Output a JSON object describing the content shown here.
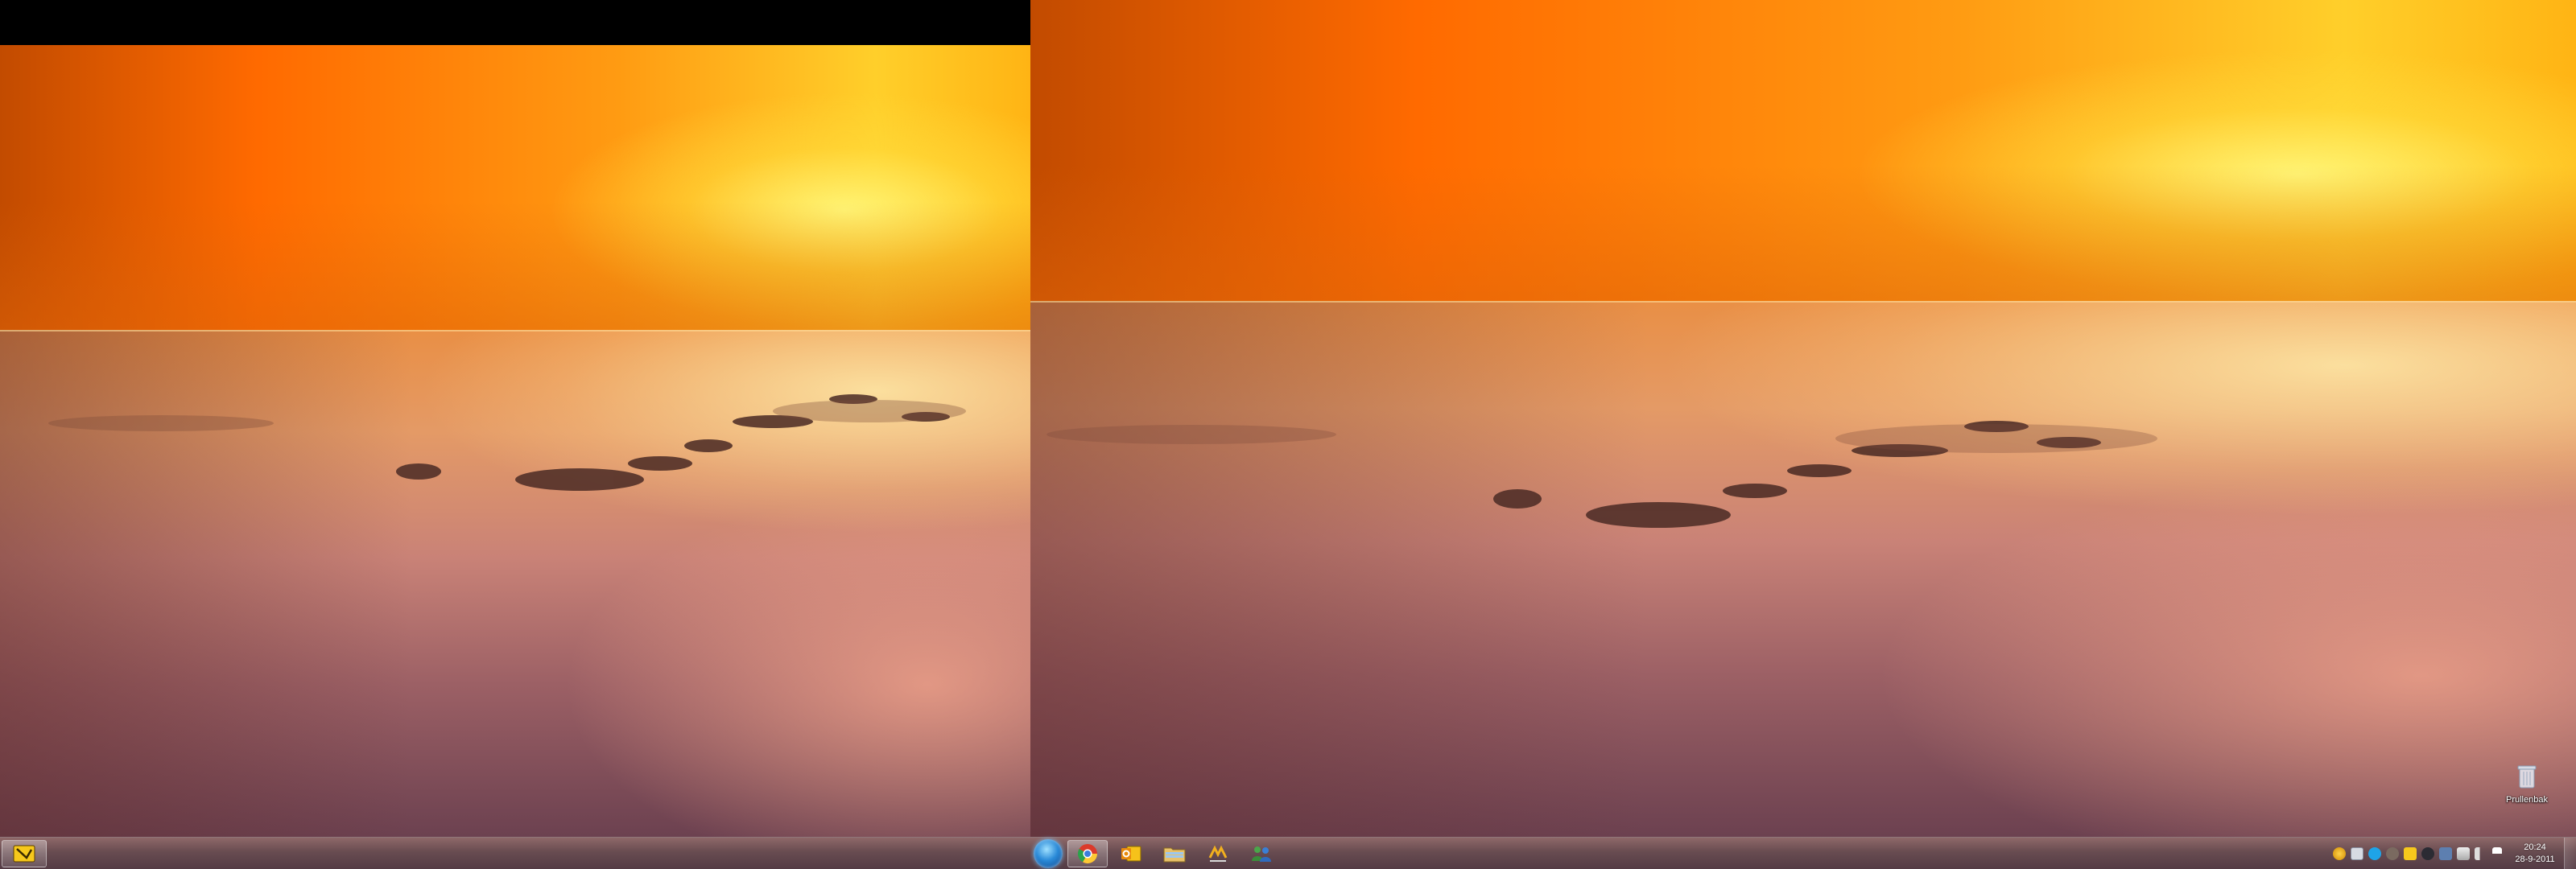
{
  "left_monitor": {
    "taskbar": {
      "buttons": [
        {
          "icon": "notes-app-icon",
          "active": true
        }
      ]
    }
  },
  "right_monitor": {
    "desktop_icons": [
      {
        "label": "Prullenbak",
        "icon": "recycle-bin-icon"
      }
    ],
    "taskbar": {
      "start_icon": "windows-start-orb-icon",
      "pinned": [
        {
          "icon": "chrome-icon",
          "active": true
        },
        {
          "icon": "outlook-icon",
          "active": false
        },
        {
          "icon": "file-explorer-icon",
          "active": false
        },
        {
          "icon": "winamp-icon",
          "active": false
        },
        {
          "icon": "messenger-icon",
          "active": false
        }
      ],
      "tray_icons": [
        "volume-warning-icon",
        "network-icon",
        "skype-icon",
        "antivirus-icon",
        "sticky-note-icon",
        "dropbox-icon",
        "display-icon",
        "power-icon",
        "speaker-icon",
        "action-center-flag-icon"
      ],
      "clock": {
        "time": "20:24",
        "date": "28-9-2011"
      }
    }
  },
  "colors": {
    "sky_top": "#c24b00",
    "sky_glow": "#ffcf2a",
    "sea_light": "#e49a66",
    "sea_dark": "#6c4150",
    "taskbar": "#6e5055"
  }
}
